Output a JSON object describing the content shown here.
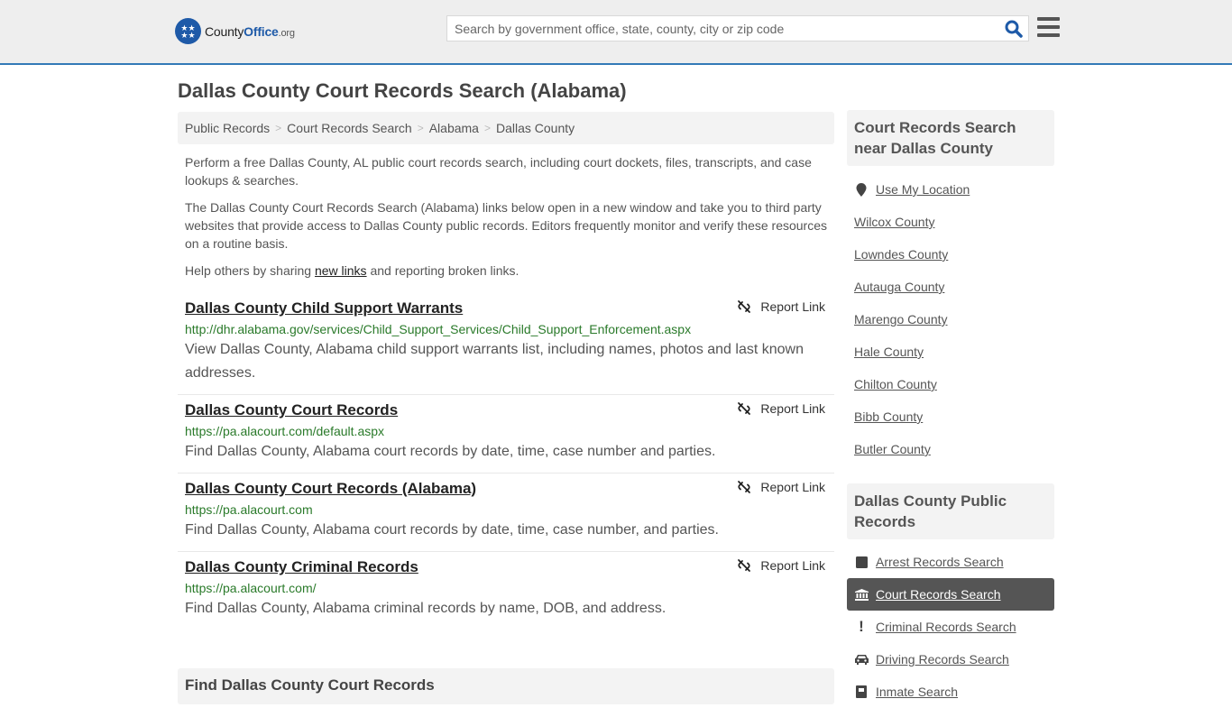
{
  "header": {
    "logo_main": "County",
    "logo_office": "Office",
    "logo_tld": ".org",
    "search_placeholder": "Search by government office, state, county, city or zip code",
    "search_icon": "search-icon",
    "menu_icon": "hamburger-menu-icon"
  },
  "page": {
    "title": "Dallas County Court Records Search (Alabama)"
  },
  "breadcrumb": [
    {
      "label": "Public Records"
    },
    {
      "label": "Court Records Search"
    },
    {
      "label": "Alabama"
    },
    {
      "label": "Dallas County"
    }
  ],
  "intro": {
    "p1": "Perform a free Dallas County, AL public court records search, including court dockets, files, transcripts, and case lookups & searches.",
    "p2": "The Dallas County Court Records Search (Alabama) links below open in a new window and take you to third party websites that provide access to Dallas County public records. Editors frequently monitor and verify these resources on a routine basis.",
    "p3_before": "Help others by sharing ",
    "p3_link": "new links",
    "p3_after": " and reporting broken links."
  },
  "links": [
    {
      "title": "Dallas County Child Support Warrants",
      "url": "http://dhr.alabama.gov/services/Child_Support_Services/Child_Support_Enforcement.aspx",
      "description": "View Dallas County, Alabama child support warrants list, including names, photos and last known addresses.",
      "report_label": "Report Link"
    },
    {
      "title": "Dallas County Court Records",
      "url": "https://pa.alacourt.com/default.aspx",
      "description": "Find Dallas County, Alabama court records by date, time, case number and parties.",
      "report_label": "Report Link"
    },
    {
      "title": "Dallas County Court Records (Alabama)",
      "url": "https://pa.alacourt.com",
      "description": "Find Dallas County, Alabama court records by date, time, case number, and parties.",
      "report_label": "Report Link"
    },
    {
      "title": "Dallas County Criminal Records",
      "url": "https://pa.alacourt.com/",
      "description": "Find Dallas County, Alabama criminal records by name, DOB, and address.",
      "report_label": "Report Link"
    }
  ],
  "find_section": {
    "title": "Find Dallas County Court Records"
  },
  "sidebar_near": {
    "title": "Court Records Search near Dallas County",
    "use_location": "Use My Location",
    "counties": [
      "Wilcox County",
      "Lowndes County",
      "Autauga County",
      "Marengo County",
      "Hale County",
      "Chilton County",
      "Bibb County",
      "Butler County"
    ]
  },
  "sidebar_public": {
    "title": "Dallas County Public Records",
    "items": [
      {
        "label": "Arrest Records Search",
        "icon": "square-icon",
        "active": false
      },
      {
        "label": "Court Records Search",
        "icon": "courthouse-icon",
        "active": true
      },
      {
        "label": "Criminal Records Search",
        "icon": "exclamation-icon",
        "active": false
      },
      {
        "label": "Driving Records Search",
        "icon": "car-icon",
        "active": false
      },
      {
        "label": "Inmate Search",
        "icon": "inmate-icon",
        "active": false
      }
    ]
  },
  "colors": {
    "accent": "#337ab7",
    "logo_blue": "#1e5aa8",
    "url_green": "#2a7a2a",
    "active_bg": "#555555"
  }
}
